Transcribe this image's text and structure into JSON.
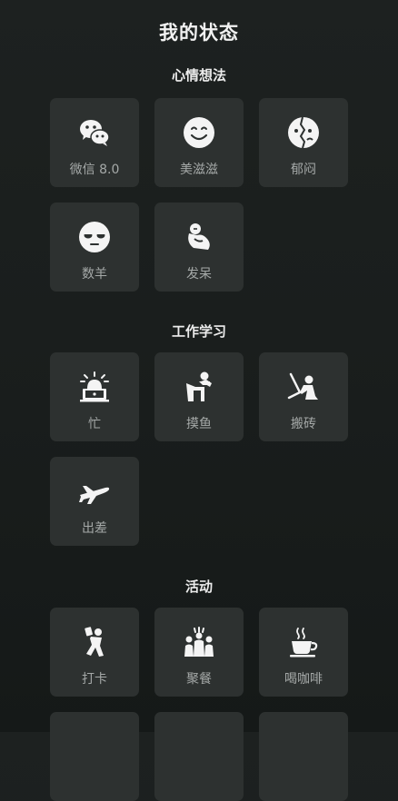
{
  "page": {
    "title": "我的状态"
  },
  "sections": [
    {
      "title": "心情想法",
      "items": [
        {
          "label": "微信 8.0",
          "icon": "wechat-icon"
        },
        {
          "label": "美滋滋",
          "icon": "smile-face-icon"
        },
        {
          "label": "郁闷",
          "icon": "depressed-face-icon"
        },
        {
          "label": "数羊",
          "icon": "sleepy-face-icon"
        },
        {
          "label": "发呆",
          "icon": "daydream-icon"
        }
      ]
    },
    {
      "title": "工作学习",
      "items": [
        {
          "label": "忙",
          "icon": "alarm-laptop-icon"
        },
        {
          "label": "摸鱼",
          "icon": "slacking-off-icon"
        },
        {
          "label": "搬砖",
          "icon": "working-person-icon"
        },
        {
          "label": "出差",
          "icon": "airplane-icon"
        }
      ]
    },
    {
      "title": "活动",
      "items": [
        {
          "label": "打卡",
          "icon": "check-in-person-icon"
        },
        {
          "label": "聚餐",
          "icon": "group-dinner-icon"
        },
        {
          "label": "喝咖啡",
          "icon": "coffee-cup-icon"
        }
      ]
    }
  ],
  "colors": {
    "background": "#1b1f1e",
    "tile": "#2d3130",
    "label": "#a5a9a8",
    "icon": "#f4f4f4"
  }
}
